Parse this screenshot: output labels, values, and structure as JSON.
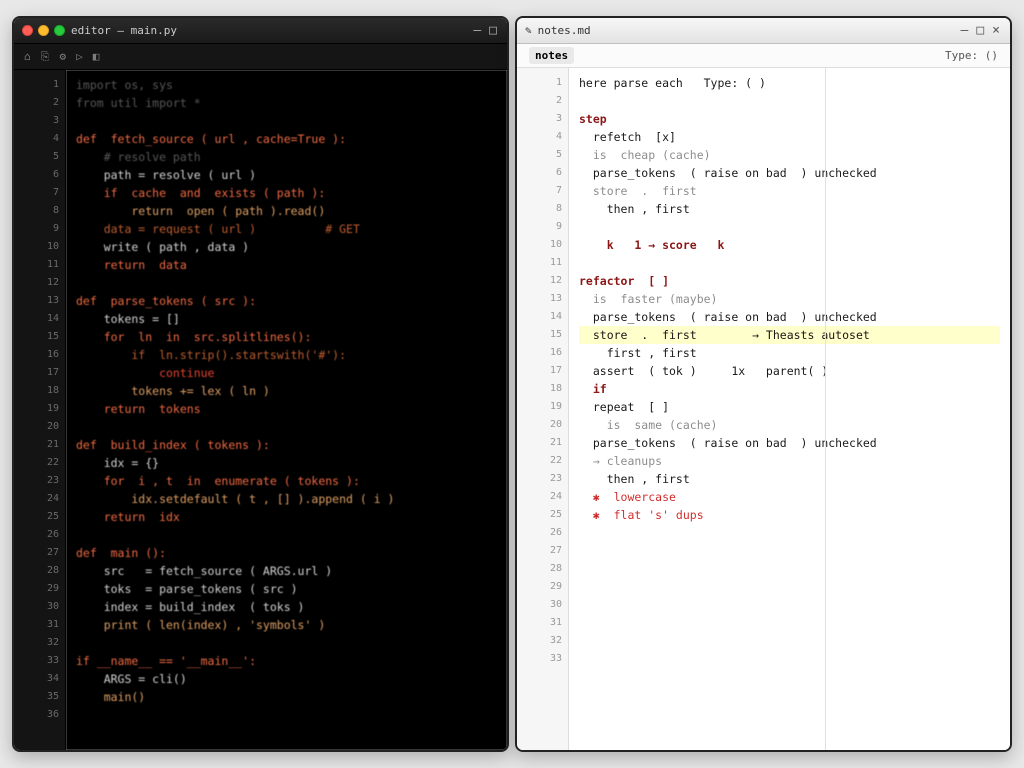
{
  "left": {
    "title": "editor – main.py",
    "toolbar": [
      "⌂",
      "⎘",
      "⚙",
      "▷",
      "◧"
    ],
    "gutter": [
      "1",
      "2",
      "3",
      "4",
      "5",
      "6",
      "7",
      "8",
      "9",
      "10",
      "11",
      "12",
      "13",
      "14",
      "15",
      "16",
      "17",
      "18",
      "19",
      "20",
      "21",
      "22",
      "23",
      "24",
      "25",
      "26",
      "27",
      "28",
      "29",
      "30",
      "31",
      "32",
      "33",
      "34",
      "35",
      "36"
    ],
    "lines": [
      {
        "t": "import os, sys",
        "cls": "dk-com"
      },
      {
        "t": "from util import *",
        "cls": "dk-com"
      },
      {
        "t": "",
        "cls": ""
      },
      {
        "t": "def  fetch_source ( url , cache=True ):",
        "cls": "dk-kw"
      },
      {
        "t": "    # resolve path",
        "cls": "dk-com"
      },
      {
        "t": "    path = resolve ( url )",
        "cls": "dk-var"
      },
      {
        "t": "    if  cache  and  exists ( path ):",
        "cls": "dk-kw"
      },
      {
        "t": "        return  open ( path ).read()",
        "cls": "dk-fn"
      },
      {
        "t": "    data = request ( url )          # GET",
        "cls": "dk-str"
      },
      {
        "t": "    write ( path , data )",
        "cls": "dk-var"
      },
      {
        "t": "    return  data",
        "cls": "dk-kw"
      },
      {
        "t": "",
        "cls": ""
      },
      {
        "t": "def  parse_tokens ( src ):",
        "cls": "dk-kw"
      },
      {
        "t": "    tokens = []",
        "cls": "dk-var"
      },
      {
        "t": "    for  ln  in  src.splitlines():",
        "cls": "dk-kw"
      },
      {
        "t": "        if  ln.strip().startswith('#'):",
        "cls": "dk-str"
      },
      {
        "t": "            continue",
        "cls": "dk-red"
      },
      {
        "t": "        tokens += lex ( ln )",
        "cls": "dk-fn"
      },
      {
        "t": "    return  tokens",
        "cls": "dk-kw"
      },
      {
        "t": "",
        "cls": ""
      },
      {
        "t": "def  build_index ( tokens ):",
        "cls": "dk-kw"
      },
      {
        "t": "    idx = {}",
        "cls": "dk-var"
      },
      {
        "t": "    for  i , t  in  enumerate ( tokens ):",
        "cls": "dk-kw"
      },
      {
        "t": "        idx.setdefault ( t , [] ).append ( i )",
        "cls": "dk-fn"
      },
      {
        "t": "    return  idx",
        "cls": "dk-kw"
      },
      {
        "t": "",
        "cls": ""
      },
      {
        "t": "def  main ():",
        "cls": "dk-kw"
      },
      {
        "t": "    src   = fetch_source ( ARGS.url )",
        "cls": "dk-var"
      },
      {
        "t": "    toks  = parse_tokens ( src )",
        "cls": "dk-var"
      },
      {
        "t": "    index = build_index  ( toks )",
        "cls": "dk-var"
      },
      {
        "t": "    print ( len(index) , 'symbols' )",
        "cls": "dk-fn"
      },
      {
        "t": "",
        "cls": ""
      },
      {
        "t": "if __name__ == '__main__':",
        "cls": "dk-kw"
      },
      {
        "t": "    ARGS = cli()",
        "cls": "dk-var"
      },
      {
        "t": "    main()",
        "cls": "dk-fn"
      },
      {
        "t": "",
        "cls": ""
      }
    ]
  },
  "right": {
    "title": "notes.md",
    "tabs": {
      "active": "notes",
      "type_label": "Type: ()"
    },
    "gutter": [
      "1",
      "2",
      "3",
      "4",
      "5",
      "6",
      "7",
      "8",
      "9",
      "10",
      "11",
      "12",
      "13",
      "14",
      "15",
      "16",
      "17",
      "18",
      "19",
      "20",
      "21",
      "22",
      "23",
      "24",
      "25",
      "26",
      "27",
      "28",
      "29",
      "30",
      "31",
      "32",
      "33"
    ],
    "lines": [
      {
        "t": "here parse each   Type: ( )",
        "cls": ""
      },
      {
        "t": "",
        "cls": ""
      },
      {
        "t": "step",
        "cls": "lt-kw"
      },
      {
        "t": "  refetch  [x]",
        "cls": ""
      },
      {
        "t": "  is  cheap (cache)",
        "cls": "lt-com"
      },
      {
        "t": "  parse_tokens  ( raise on bad  ) unchecked",
        "cls": ""
      },
      {
        "t": "  store  .  first",
        "cls": "lt-com"
      },
      {
        "t": "    then , first",
        "cls": ""
      },
      {
        "t": "",
        "cls": ""
      },
      {
        "t": "    k   1 → score   k",
        "cls": "lt-kw"
      },
      {
        "t": "",
        "cls": ""
      },
      {
        "t": "refactor  [ ]",
        "cls": "lt-kw"
      },
      {
        "t": "  is  faster (maybe)",
        "cls": "lt-com"
      },
      {
        "t": "  parse_tokens  ( raise on bad  ) unchecked",
        "cls": ""
      },
      {
        "t": "  store  .  first        → Theasts autoset",
        "cls": "lt-hl"
      },
      {
        "t": "    first , first",
        "cls": ""
      },
      {
        "t": "  assert  ( tok )     1x   parent( )",
        "cls": ""
      },
      {
        "t": "  if",
        "cls": "lt-kw"
      },
      {
        "t": "  repeat  [ ]",
        "cls": ""
      },
      {
        "t": "    is  same (cache)",
        "cls": "lt-com"
      },
      {
        "t": "  parse_tokens  ( raise on bad  ) unchecked",
        "cls": ""
      },
      {
        "t": "  → cleanups",
        "cls": "lt-com"
      },
      {
        "t": "    then , first",
        "cls": ""
      },
      {
        "t": "  ✱  lowercase",
        "cls": "lt-red"
      },
      {
        "t": "  ✱  flat 's' dups",
        "cls": "lt-red"
      },
      {
        "t": "",
        "cls": ""
      },
      {
        "t": "",
        "cls": ""
      },
      {
        "t": "",
        "cls": ""
      },
      {
        "t": "",
        "cls": ""
      },
      {
        "t": "",
        "cls": ""
      },
      {
        "t": "",
        "cls": ""
      },
      {
        "t": "",
        "cls": ""
      },
      {
        "t": "",
        "cls": ""
      }
    ]
  }
}
